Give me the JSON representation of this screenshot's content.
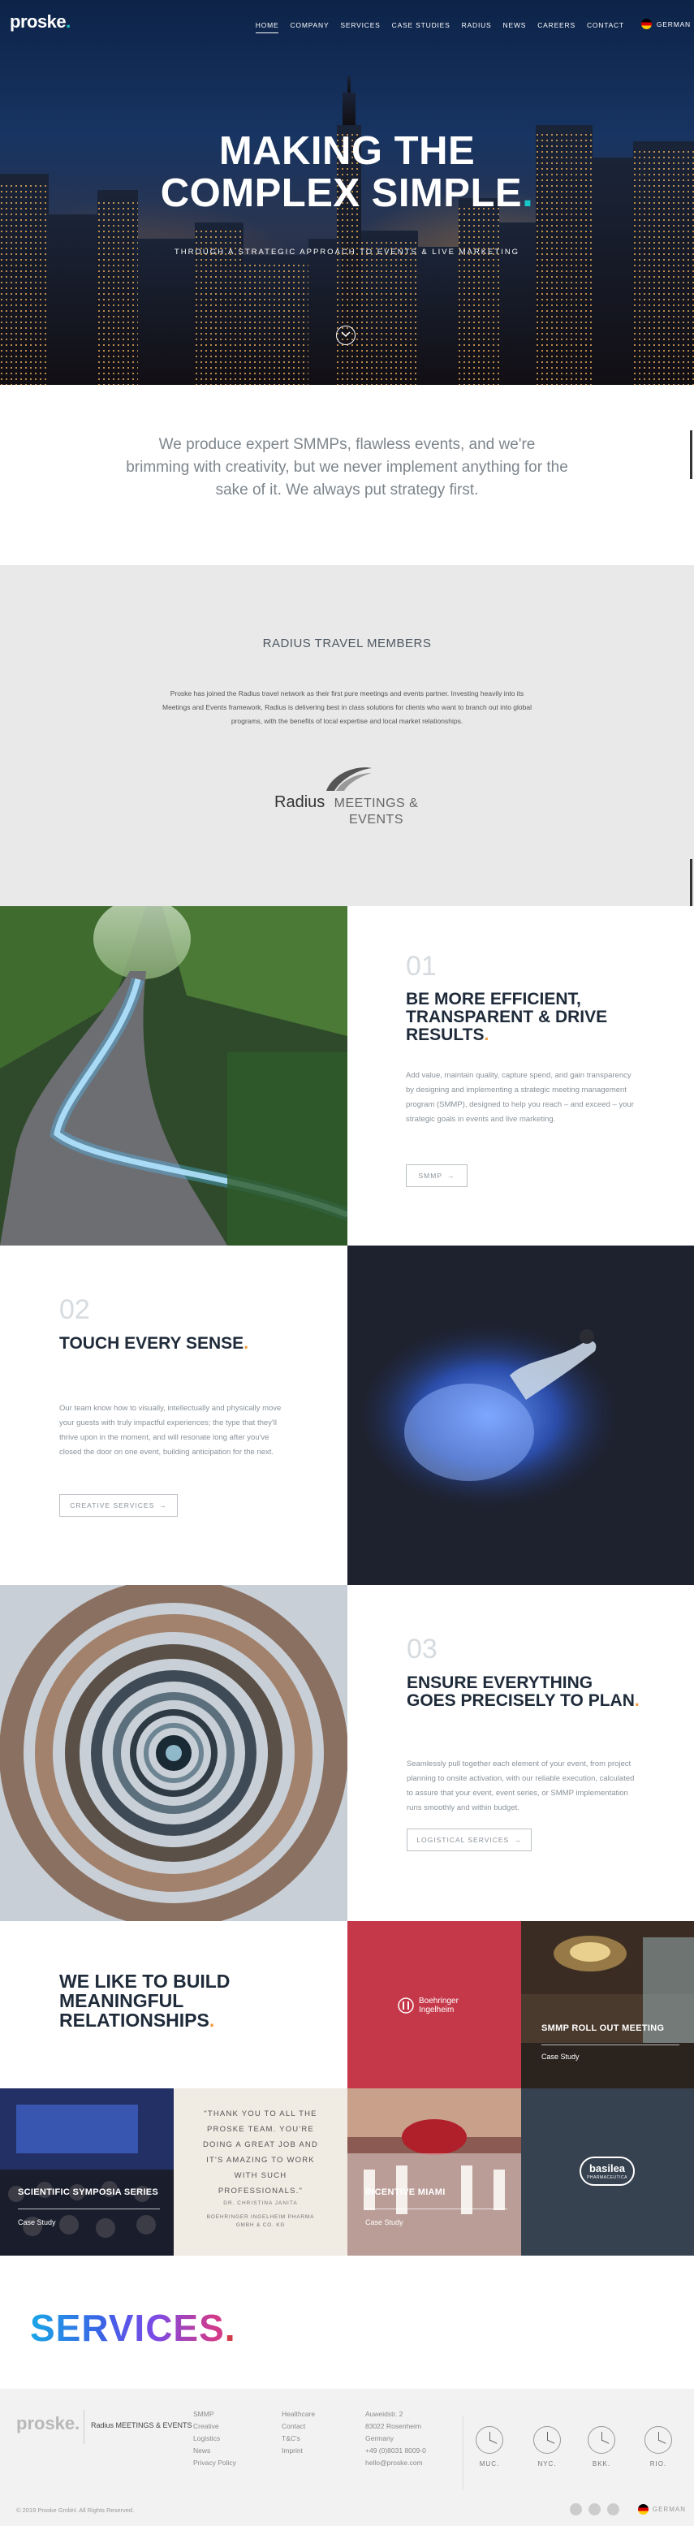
{
  "nav": {
    "logo": "proske",
    "logo_dot": ".",
    "items": [
      "HOME",
      "COMPANY",
      "SERVICES",
      "CASE STUDIES",
      "RADIUS",
      "NEWS",
      "CAREERS",
      "CONTACT"
    ],
    "language": "GERMAN"
  },
  "hero": {
    "title_line1": "MAKING THE",
    "title_line2": "COMPLEX SIMPLE",
    "title_dot": ".",
    "subtitle": "THROUGH A STRATEGIC APPROACH TO EVENTS & LIVE MARKETING"
  },
  "intro": {
    "text": "We produce expert SMMPs, flawless events, and we're brimming with creativity, but we never implement anything for the sake of it. We always put strategy first."
  },
  "radius": {
    "title": "RADIUS TRAVEL MEMBERS",
    "text": "Proske has joined the Radius travel network as their first pure meetings and events partner. Investing heavily into its Meetings and Events framework, Radius is delivering best in class solutions for clients who want to branch out into global programs, with the benefits of local expertise and local market relationships.",
    "logo_word": "Radius",
    "logo_sub": "MEETINGS & EVENTS"
  },
  "features": [
    {
      "num": "01",
      "title": "BE MORE EFFICIENT, TRANSPARENT & DRIVE RESULTS",
      "dot": ".",
      "body": "Add value, maintain quality, capture spend, and gain transparency by designing and implementing a strategic meeting management program (SMMP), designed to help you reach – and exceed – your strategic goals in events and live marketing.",
      "button": "SMMP"
    },
    {
      "num": "02",
      "title": "TOUCH EVERY SENSE",
      "dot": ".",
      "body": "Our team know how to visually, intellectually and physically move your guests with truly impactful experiences; the type that they'll thrive upon in the moment, and will resonate long after you've closed the door on one event, building anticipation for the next.",
      "button": "CREATIVE SERVICES"
    },
    {
      "num": "03",
      "title": "ENSURE EVERYTHING GOES PRECISELY TO PLAN",
      "dot": ".",
      "body": "Seamlessly pull together each element of your event, from project planning to onsite activation, with our reliable execution, calculated to assure that your event, event series, or SMMP implementation runs smoothly and within budget.",
      "button": "LOGISTICAL SERVICES"
    }
  ],
  "relationships": {
    "heading": "WE LIKE TO BUILD MEANINGFUL RELATIONSHIPS",
    "dot": ".",
    "boehringer": "Boehringer Ingelheim",
    "smmp_rollout": "SMMP ROLL OUT MEETING",
    "case_study": "Case Study",
    "symposia": "SCIENTIFIC SYMPOSIA SERIES",
    "quote": "\"THANK YOU TO ALL THE PROSKE TEAM. YOU'RE DOING A GREAT JOB AND IT'S AMAZING TO WORK WITH SUCH PROFESSIONALS.\"",
    "quote_author": "DR. CHRISTINA JANITA",
    "quote_company": "BOEHRINGER INGELHEIM PHARMA GMBH & CO. KG",
    "miami": "INCENTIVE MIAMI",
    "basilea": "basilea",
    "basilea_sub": "PHARMACEUTICA"
  },
  "services": {
    "title": "SERVICES",
    "dot": "."
  },
  "footer": {
    "logo": "proske.",
    "radius": "Radius MEETINGS & EVENTS",
    "col1": [
      "SMMP",
      "Creative",
      "Logistics",
      "News",
      "Privacy Policy"
    ],
    "col2": [
      "Healthcare",
      "Contact",
      "T&C's",
      "Imprint"
    ],
    "address": [
      "Auweidstr. 2",
      "83022 Rosenheim",
      "Germany",
      "+49 (0)8031 8009-0",
      "hello@proske.com"
    ],
    "clocks": [
      "MUC.",
      "NYC.",
      "BKK.",
      "RIO."
    ],
    "copyright": "© 2019 Proske GmbH. All Rights Reserved.",
    "language": "GERMAN"
  },
  "colors": {
    "accent_teal": "#17c6c6",
    "accent_orange": "#f29a3a",
    "boehringer_red": "#c53849",
    "basilea_navy": "#374250"
  }
}
